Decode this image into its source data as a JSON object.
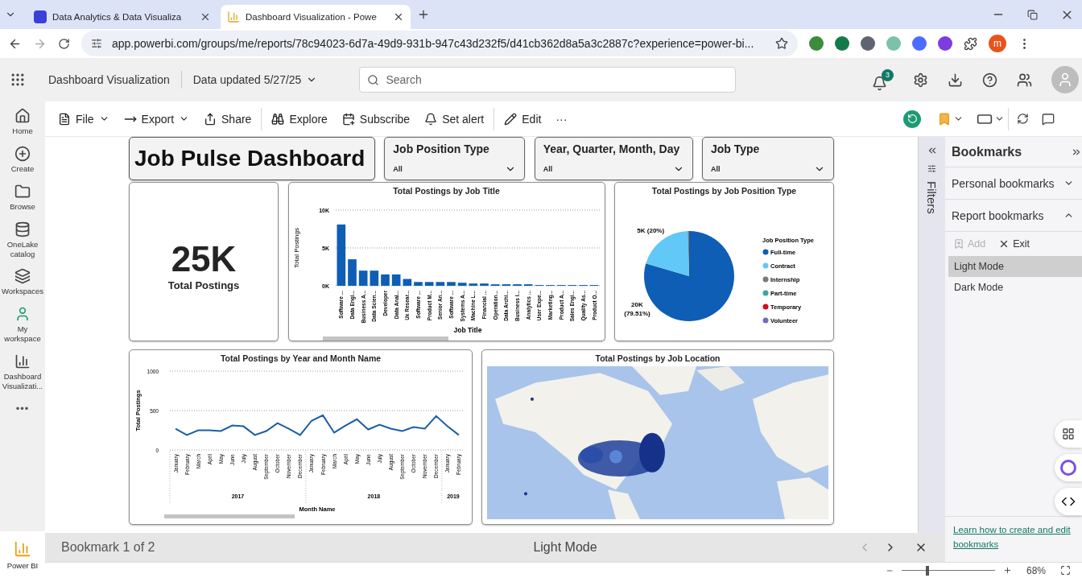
{
  "browser": {
    "tabs": [
      {
        "title": "Data Analytics & Data Visualiza",
        "selected": false
      },
      {
        "title": "Dashboard Visualization - Powe",
        "selected": true
      }
    ],
    "address": "app.powerbi.com/groups/me/reports/78c94023-6d7a-49d9-931b-947c43d232f5/d41cb362d8a5a3c2887c?experience=power-bi...",
    "profile_initial": "m"
  },
  "app": {
    "report_name": "Dashboard Visualization",
    "data_updated": "Data updated 5/27/25",
    "search": {
      "placeholder": "Search"
    },
    "notifications": "3"
  },
  "nav": [
    {
      "label": "Home",
      "kind": "home"
    },
    {
      "label": "Create",
      "kind": "create"
    },
    {
      "label": "Browse",
      "kind": "browse"
    },
    {
      "label": "OneLake catalog",
      "kind": "onelake"
    },
    {
      "label": "Workspaces",
      "kind": "workspaces"
    },
    {
      "label": "My workspace",
      "kind": "myworkspace"
    },
    {
      "label": "Dashboard Visualizati...",
      "kind": "report"
    }
  ],
  "nav_more": "•••",
  "brand": "Power BI",
  "toolbar": [
    {
      "label": "File",
      "kind": "file",
      "dropdown": true
    },
    {
      "label": "Export",
      "kind": "export",
      "dropdown": true
    },
    {
      "label": "Share",
      "kind": "share",
      "dropdown": false
    },
    {
      "label": "Explore",
      "kind": "explore",
      "dropdown": false
    },
    {
      "label": "Subscribe",
      "kind": "subscribe",
      "dropdown": false
    },
    {
      "label": "Set alert",
      "kind": "alert",
      "dropdown": false
    },
    {
      "label": "Edit",
      "kind": "edit",
      "dropdown": false
    }
  ],
  "toolbar_more": "···",
  "report": {
    "title": "Job Pulse Dashboard",
    "slicers": [
      {
        "title": "Job Position Type",
        "value": "All"
      },
      {
        "title": "Year, Quarter, Month, Day",
        "value": "All"
      },
      {
        "title": "Job Type",
        "value": "All"
      }
    ],
    "card": {
      "value": "25K",
      "label": "Total Postings"
    },
    "bar_chart": {
      "chart_data": {
        "type": "bar",
        "title": "Total Postings by Job Title",
        "xlabel": "Job Title",
        "ylabel": "Total Postings",
        "categories": [
          "Software ...",
          "Data Engi...",
          "Business A...",
          "Data Scien...",
          "Developer",
          "Data Anal...",
          "Ux Resear...",
          "Software ...",
          "Product M...",
          "Senior An...",
          "Software ...",
          "Systems A...",
          "Machine L...",
          "Financial ...",
          "Operation...",
          "Data Archi...",
          "Business I...",
          "Analytics ...",
          "User Expe...",
          "Marketing...",
          "Product A...",
          "Sales Engi...",
          "Quality As...",
          "Product O..."
        ],
        "values": [
          8100,
          3500,
          2000,
          2000,
          1500,
          1500,
          900,
          500,
          500,
          500,
          500,
          400,
          300,
          300,
          200,
          200,
          200,
          200,
          100,
          100,
          100,
          100,
          100,
          100
        ],
        "ylim": [
          0,
          10000
        ],
        "yticks": [
          {
            "value": 0,
            "label": "0K"
          },
          {
            "value": 5000,
            "label": "5K"
          },
          {
            "value": 10000,
            "label": "10K"
          }
        ]
      }
    },
    "pie_chart": {
      "chart_data": {
        "type": "pie",
        "title": "Total Postings by Job Position Type",
        "legend": {
          "title": "Job Position Type"
        },
        "categories": [
          "Full-time",
          "Contract",
          "Internship",
          "Part-time",
          "Temporary",
          "Volunteer"
        ],
        "values": [
          79.51,
          20,
          0.49,
          null,
          null,
          null
        ],
        "colors": [
          "#0e5eb5",
          "#62c8f7",
          "#7a7a7a",
          "#3ea3a3",
          "#d60b1f",
          "#6f6cb8"
        ],
        "value_labels": [
          "20K (79.51%)",
          "5K (20%)",
          null,
          null,
          null,
          null
        ]
      }
    },
    "line_chart": {
      "chart_data": {
        "type": "line",
        "title": "Total Postings by Year and Month Name",
        "xlabel": "Month Name",
        "ylabel": "Total Postings",
        "categories": [
          "January",
          "February",
          "March",
          "April",
          "May",
          "June",
          "July",
          "August",
          "September",
          "October",
          "November",
          "December",
          "January",
          "February",
          "March",
          "April",
          "May",
          "June",
          "July",
          "August",
          "September",
          "October",
          "November",
          "December",
          "January",
          "February"
        ],
        "values": [
          270,
          190,
          250,
          250,
          240,
          310,
          300,
          190,
          240,
          340,
          270,
          190,
          370,
          440,
          220,
          310,
          390,
          260,
          320,
          270,
          240,
          290,
          270,
          430,
          300,
          190
        ],
        "ylim": [
          0,
          1000
        ],
        "yticks": [
          0,
          500,
          1000
        ]
      },
      "years": [
        "2017",
        "2018",
        "2019"
      ]
    },
    "map": {
      "title": "Total Postings by Job Location",
      "kind": "picture"
    }
  },
  "filters": {
    "label": "Filters"
  },
  "bookmarks": {
    "title": "Bookmarks",
    "sections": [
      {
        "label": "Personal bookmarks",
        "expanded": false
      },
      {
        "label": "Report bookmarks",
        "expanded": true
      }
    ],
    "actions": [
      {
        "label": "Add",
        "kind": "add",
        "disabled": true
      },
      {
        "label": "Exit",
        "kind": "exit",
        "disabled": false
      }
    ],
    "items": [
      {
        "label": "Light Mode",
        "selected": true
      },
      {
        "label": "Dark Mode",
        "selected": false
      }
    ],
    "help_link": "Learn how to create and edit bookmarks"
  },
  "bookmark_bar": {
    "position": "Bookmark 1 of 2",
    "current": "Light Mode",
    "previous_disabled": true,
    "next_disabled": false
  },
  "status": {
    "zoom": "68%",
    "level": 0.28
  }
}
